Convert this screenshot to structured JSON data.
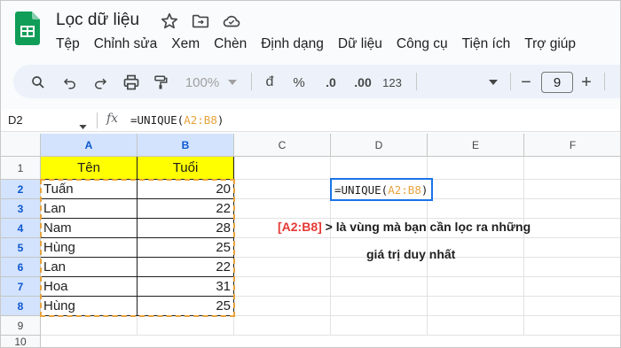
{
  "doc": {
    "title": "Lọc dữ liệu"
  },
  "menu": [
    "Tệp",
    "Chỉnh sửa",
    "Xem",
    "Chèn",
    "Định dạng",
    "Dữ liệu",
    "Công cụ",
    "Tiện ích",
    "Trợ giúp"
  ],
  "toolbar": {
    "zoom": "100%",
    "currency": "đ",
    "percent": "%",
    "dec_decrease": ".0",
    "dec_increase": ".00",
    "number_format": "123",
    "font_size": "9",
    "minus": "−",
    "plus": "+"
  },
  "formula_bar": {
    "cell_ref": "D2",
    "fx": "fx",
    "formula_prefix": "=UNIQUE(",
    "formula_range": "A2:B8",
    "formula_suffix": ")"
  },
  "columns": [
    "A",
    "B",
    "C",
    "D",
    "E",
    "F"
  ],
  "rows": [
    "1",
    "2",
    "3",
    "4",
    "5",
    "6",
    "7",
    "8",
    "9",
    "10"
  ],
  "table": {
    "headers": [
      "Tên",
      "Tuổi"
    ],
    "rows": [
      [
        "Tuấn",
        "20"
      ],
      [
        "Lan",
        "22"
      ],
      [
        "Nam",
        "28"
      ],
      [
        "Hùng",
        "25"
      ],
      [
        "Lan",
        "22"
      ],
      [
        "Hoa",
        "31"
      ],
      [
        "Hùng",
        "25"
      ]
    ]
  },
  "active_cell": {
    "prefix": "=UNIQUE(",
    "range": "A2:B8",
    "suffix": ")"
  },
  "annotation": {
    "range": "[A2:B8]",
    "line1": " > là vùng mà bạn cần lọc ra những",
    "line2": "giá trị duy nhất"
  },
  "colors": {
    "accent": "#1a73e8",
    "header_fill": "#ffff00",
    "range_ref": "#e8a33d",
    "annotation_red": "#e53935"
  }
}
